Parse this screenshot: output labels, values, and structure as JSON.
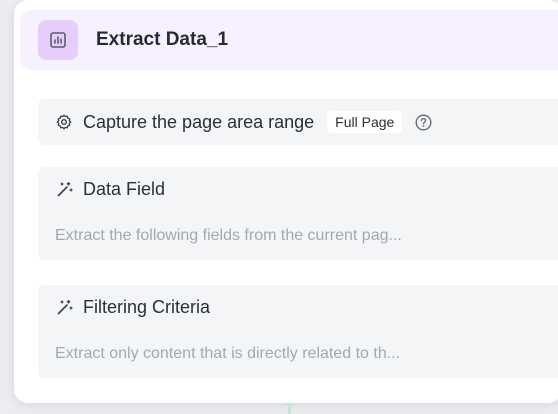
{
  "node": {
    "title": "Extract Data_1",
    "header_icon": "bar-chart-icon",
    "accent_color": "#e7cdfb",
    "header_bg": "#f7f1ff"
  },
  "capture": {
    "label": "Capture the page area range",
    "value": "Full Page",
    "icon": "gear-icon",
    "help_icon": "question-circle-icon"
  },
  "fields": [
    {
      "icon": "magic-wand-icon",
      "title": "Data Field",
      "description": "Extract the following fields from the current pag..."
    },
    {
      "icon": "magic-wand-icon",
      "title": "Filtering Criteria",
      "description": "Extract only content that is directly related to th..."
    }
  ],
  "connectors": {
    "top_color": "#2fd38a",
    "bottom_color": "#b7efd6"
  }
}
